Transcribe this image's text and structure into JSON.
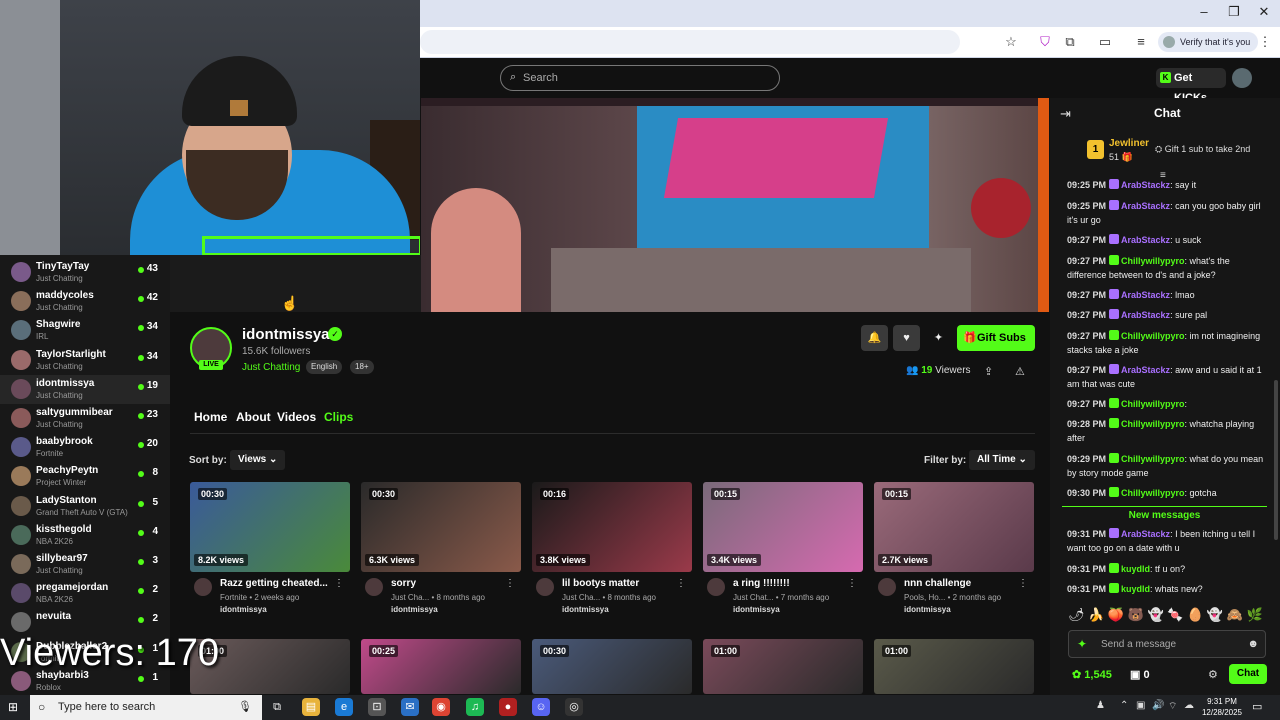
{
  "browser": {
    "verify_label": "Verify that it's you"
  },
  "header": {
    "search_placeholder": "Search",
    "get_kicks": "Get KICKs"
  },
  "sidebar": {
    "items": [
      {
        "name": "TinyTayTay",
        "category": "Just Chatting",
        "viewers": "43",
        "color": "#7a5a8a"
      },
      {
        "name": "maddycoles",
        "category": "Just Chatting",
        "viewers": "42",
        "color": "#8a6e5a"
      },
      {
        "name": "Shagwire",
        "category": "IRL",
        "viewers": "34",
        "color": "#5a6e7a"
      },
      {
        "name": "TaylorStarlight",
        "category": "Just Chatting",
        "viewers": "34",
        "color": "#9a6a6a"
      },
      {
        "name": "idontmissya",
        "category": "Just Chatting",
        "viewers": "19",
        "color": "#6a4a5a"
      },
      {
        "name": "saltygummibear",
        "category": "Just Chatting",
        "viewers": "23",
        "color": "#8a5a5a"
      },
      {
        "name": "baabybrook",
        "category": "Fortnite",
        "viewers": "20",
        "color": "#5a5a8a"
      },
      {
        "name": "PeachyPeytn",
        "category": "Project Winter",
        "viewers": "8",
        "color": "#9a7a5a"
      },
      {
        "name": "LadyStanton",
        "category": "Grand Theft Auto V (GTA)",
        "viewers": "5",
        "color": "#6a5a4a"
      },
      {
        "name": "kissthegold",
        "category": "NBA 2K26",
        "viewers": "4",
        "color": "#4a6a5a"
      },
      {
        "name": "sillybear97",
        "category": "Just Chatting",
        "viewers": "3",
        "color": "#7a6a5a"
      },
      {
        "name": "pregamejordan",
        "category": "NBA 2K26",
        "viewers": "2",
        "color": "#5a4a6a"
      },
      {
        "name": "nevuita",
        "category": "",
        "viewers": "2",
        "color": "#6a6a6a"
      },
      {
        "name": "Dubblezballer2",
        "category": "Fortnite",
        "viewers": "1",
        "color": "#5a6a4a"
      },
      {
        "name": "shaybarbi3",
        "category": "Roblox",
        "viewers": "1",
        "color": "#8a5a7a"
      }
    ]
  },
  "overlay": {
    "viewers_text": "Viewers: 170"
  },
  "streamer": {
    "name": "idontmissya",
    "followers": "15.6K followers",
    "category": "Just Chatting",
    "tags": [
      "English",
      "18+"
    ],
    "live": "LIVE",
    "viewer_count": "19",
    "viewers_label": "Viewers",
    "gift_subs": "Gift Subs"
  },
  "tabs": [
    "Home",
    "About",
    "Videos",
    "Clips"
  ],
  "sort": {
    "label": "Sort by:",
    "value": "Views",
    "filter_label": "Filter by:",
    "filter_value": "All Time"
  },
  "clips": [
    {
      "duration": "00:30",
      "views": "8.2K views",
      "title": "Razz getting cheated...",
      "category": "Fortnite",
      "age": "2 weeks ago",
      "user": "idontmissya",
      "color1": "#3a5a9a",
      "color2": "#4a8a3a"
    },
    {
      "duration": "00:30",
      "views": "6.3K views",
      "title": "sorry",
      "category": "Just Cha...",
      "age": "8 months ago",
      "user": "idontmissya",
      "color1": "#2a2a2a",
      "color2": "#8a5a4a"
    },
    {
      "duration": "00:16",
      "views": "3.8K views",
      "title": "lil bootys matter",
      "category": "Just Cha...",
      "age": "8 months ago",
      "user": "idontmissya",
      "color1": "#1a1a1a",
      "color2": "#9a3a4a"
    },
    {
      "duration": "00:15",
      "views": "3.4K views",
      "title": "a ring !!!!!!!!",
      "category": "Just Chat...",
      "age": "7 months ago",
      "user": "idontmissya",
      "color1": "#7a6a7a",
      "color2": "#d66ab0"
    },
    {
      "duration": "00:15",
      "views": "2.7K views",
      "title": "nnn challenge",
      "category": "Pools, Ho...",
      "age": "2 months ago",
      "user": "idontmissya",
      "color1": "#9a6a7a",
      "color2": "#5a3a4a"
    }
  ],
  "clips_row2": [
    {
      "duration": "01:00",
      "color1": "#6a5a5a"
    },
    {
      "duration": "00:25",
      "color1": "#c04a8a"
    },
    {
      "duration": "00:30",
      "color1": "#4a5a7a"
    },
    {
      "duration": "01:00",
      "color1": "#7a4a5a"
    },
    {
      "duration": "01:00",
      "color1": "#5a5a4a"
    }
  ],
  "chat": {
    "title": "Chat",
    "pinned": {
      "badge": "1",
      "name": "Jewliner",
      "count": "51",
      "gift_text": "Gift 1 sub to take 2nd"
    },
    "messages": [
      {
        "time": "09:25 PM",
        "user": "ArabStackz",
        "text": ": say it",
        "color": "#a970ff"
      },
      {
        "time": "09:25 PM",
        "user": "ArabStackz",
        "text": ": can you goo baby girl it's ur go",
        "color": "#a970ff"
      },
      {
        "time": "09:27 PM",
        "user": "ArabStackz",
        "text": ": u suck",
        "color": "#a970ff"
      },
      {
        "time": "09:27 PM",
        "user": "Chillywillypyro",
        "text": ": what's the difference between to d's and a joke?",
        "color": "#53fc18"
      },
      {
        "time": "09:27 PM",
        "user": "ArabStackz",
        "text": ": lmao",
        "color": "#a970ff"
      },
      {
        "time": "09:27 PM",
        "user": "ArabStackz",
        "text": ": sure pal",
        "color": "#a970ff"
      },
      {
        "time": "09:27 PM",
        "user": "Chillywillypyro",
        "text": ": im not imagineing stacks take a joke",
        "color": "#53fc18"
      },
      {
        "time": "09:27 PM",
        "user": "ArabStackz",
        "text": ": aww and u said it at 1 am that was cute",
        "color": "#a970ff"
      },
      {
        "time": "09:27 PM",
        "user": "Chillywillypyro",
        "text": ":",
        "color": "#53fc18"
      },
      {
        "time": "09:28 PM",
        "user": "Chillywillypyro",
        "text": ": whatcha playing after",
        "color": "#53fc18"
      },
      {
        "time": "09:29 PM",
        "user": "Chillywillypyro",
        "text": ": what do you mean by story mode game",
        "color": "#53fc18"
      },
      {
        "time": "09:30 PM",
        "user": "Chillywillypyro",
        "text": ": gotcha",
        "color": "#53fc18"
      }
    ],
    "new_messages": "New messages",
    "new": [
      {
        "time": "09:31 PM",
        "user": "ArabStackz",
        "text": ": I been itching u tell I want too go on a date with u",
        "color": "#a970ff"
      },
      {
        "time": "09:31 PM",
        "user": "kuydld",
        "text": ": tf u on?",
        "color": "#53fc18"
      },
      {
        "time": "09:31 PM",
        "user": "kuydld",
        "text": ": whats new?",
        "color": "#53fc18"
      }
    ],
    "emotes": "🌶 🍌 🍑 🐻 👻 🍬 🥚 👻 🙈 🌿",
    "input_placeholder": "Send a message",
    "kicks": "1,545",
    "subs": "0",
    "send_button": "Chat"
  },
  "taskbar": {
    "search_placeholder": "Type here to search",
    "time": "9:31 PM",
    "date": "12/28/2025"
  }
}
